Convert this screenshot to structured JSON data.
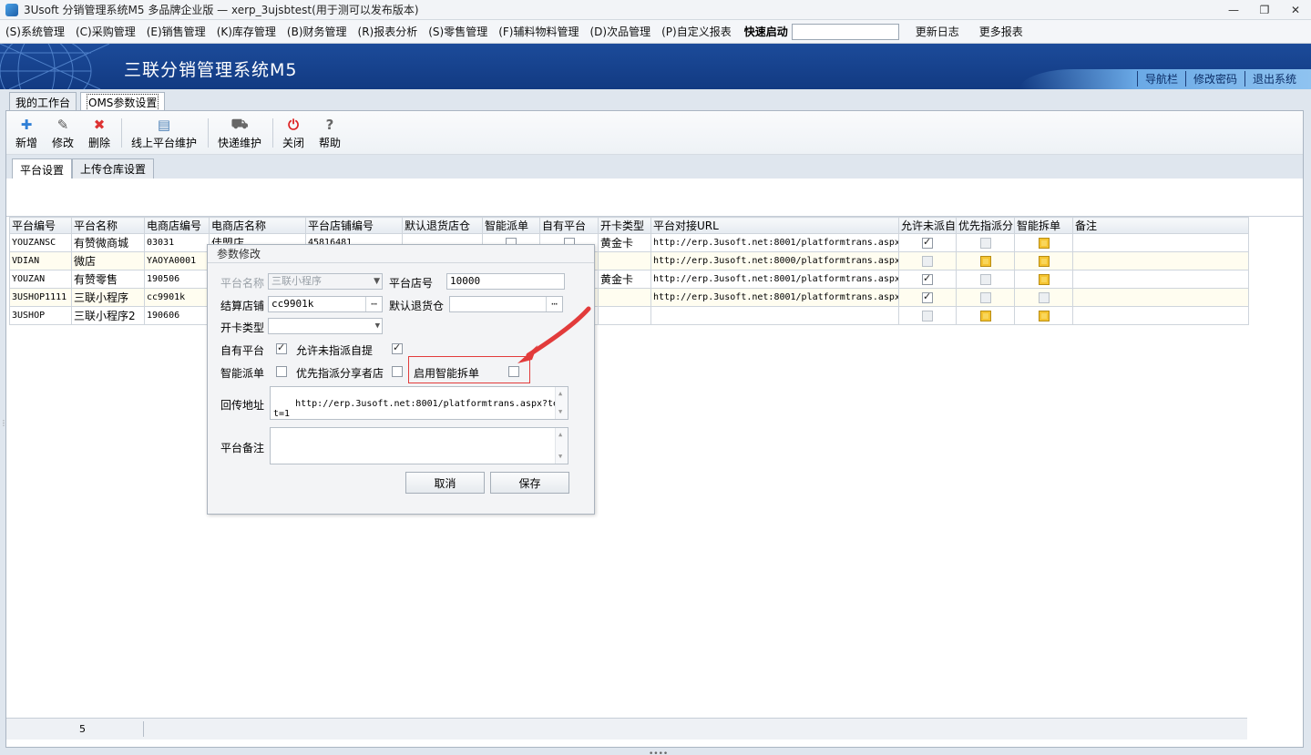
{
  "window": {
    "title": "3Usoft 分销管理系统M5 多品牌企业版 — xerp_3ujsbtest(用于测可以发布版本)"
  },
  "menu": {
    "items": [
      "(S)系统管理",
      "(C)采购管理",
      "(E)销售管理",
      "(K)库存管理",
      "(B)财务管理",
      "(R)报表分析",
      "(S)零售管理",
      "(F)辅料物料管理",
      "(D)次品管理",
      "(P)自定义报表"
    ],
    "quick_start_label": "快速启动",
    "changelog": "更新日志",
    "more_reports": "更多报表"
  },
  "banner": {
    "brand": "三联分销管理系统M5",
    "nav": "导航栏",
    "change_password": "修改密码",
    "logout": "退出系统"
  },
  "workspace_tabs": {
    "my_workbench": "我的工作台",
    "oms_settings": "OMS参数设置"
  },
  "toolbar": {
    "add": "新增",
    "edit": "修改",
    "delete": "删除",
    "online_platform": "线上平台维护",
    "express": "快递维护",
    "close": "关闭",
    "help": "帮助"
  },
  "sub_tabs": {
    "platform": "平台设置",
    "upload_warehouse": "上传仓库设置"
  },
  "grid": {
    "headers": [
      "平台编号",
      "平台名称",
      "电商店编号",
      "电商店名称",
      "平台店铺编号",
      "默认退货店仓",
      "智能派单",
      "自有平台",
      "开卡类型",
      "平台对接URL",
      "允许未派自",
      "优先指派分",
      "智能拆单",
      "备注"
    ],
    "rows": [
      {
        "code": "YOUZANSC",
        "name": "有赞微商城",
        "shop_code": "03031",
        "shop_name": "佳盟店",
        "store_no": "45816481",
        "card": "黄金卡",
        "url": "http://erp.3usoft.net:8001/platformtrans.aspx",
        "allow": "on",
        "priority": "off",
        "split": "gold"
      },
      {
        "code": "VDIAN",
        "name": "微店",
        "shop_code": "YAOYA0001",
        "shop_name": "",
        "store_no": "",
        "card": "",
        "url": "http://erp.3usoft.net:8000/platformtrans.aspx",
        "allow": "off",
        "priority": "gold",
        "split": "gold"
      },
      {
        "code": "YOUZAN",
        "name": "有赞零售",
        "shop_code": "190506",
        "shop_name": "",
        "store_no": "",
        "card": "黄金卡",
        "url": "http://erp.3usoft.net:8001/platformtrans.aspx",
        "allow": "on",
        "priority": "off",
        "split": "gold"
      },
      {
        "code": "3USHOP1111",
        "name": "三联小程序",
        "shop_code": "cc9901k",
        "shop_name": "",
        "store_no": "",
        "card": "",
        "url": "http://erp.3usoft.net:8001/platformtrans.aspx",
        "allow": "on",
        "priority": "off",
        "split": "off"
      },
      {
        "code": "3USHOP",
        "name": "三联小程序2",
        "shop_code": "190606",
        "shop_name": "",
        "store_no": "",
        "card": "",
        "url": "",
        "allow": "off",
        "priority": "gold",
        "split": "gold"
      }
    ],
    "row_count": "5"
  },
  "dialog": {
    "title": "参数修改",
    "platform_name_label": "平台名称",
    "platform_name_value": "三联小程序",
    "store_no_label": "平台店号",
    "store_no_value": "10000",
    "settle_shop_label": "结算店铺",
    "settle_shop_value": "cc9901k",
    "return_wh_label": "默认退货仓",
    "card_type_label": "开卡类型",
    "own_platform_label": "自有平台",
    "allow_self_pickup_label": "允许未指派自提",
    "smart_dispatch_label": "智能派单",
    "priority_share_label": "优先指派分享者店",
    "smart_split_label": "启用智能拆单",
    "callback_label": "回传地址",
    "callback_value": "http://erp.3usoft.net:8001/platformtrans.aspx?test=1",
    "remark_label": "平台备注",
    "cancel": "取消",
    "save": "保存"
  }
}
